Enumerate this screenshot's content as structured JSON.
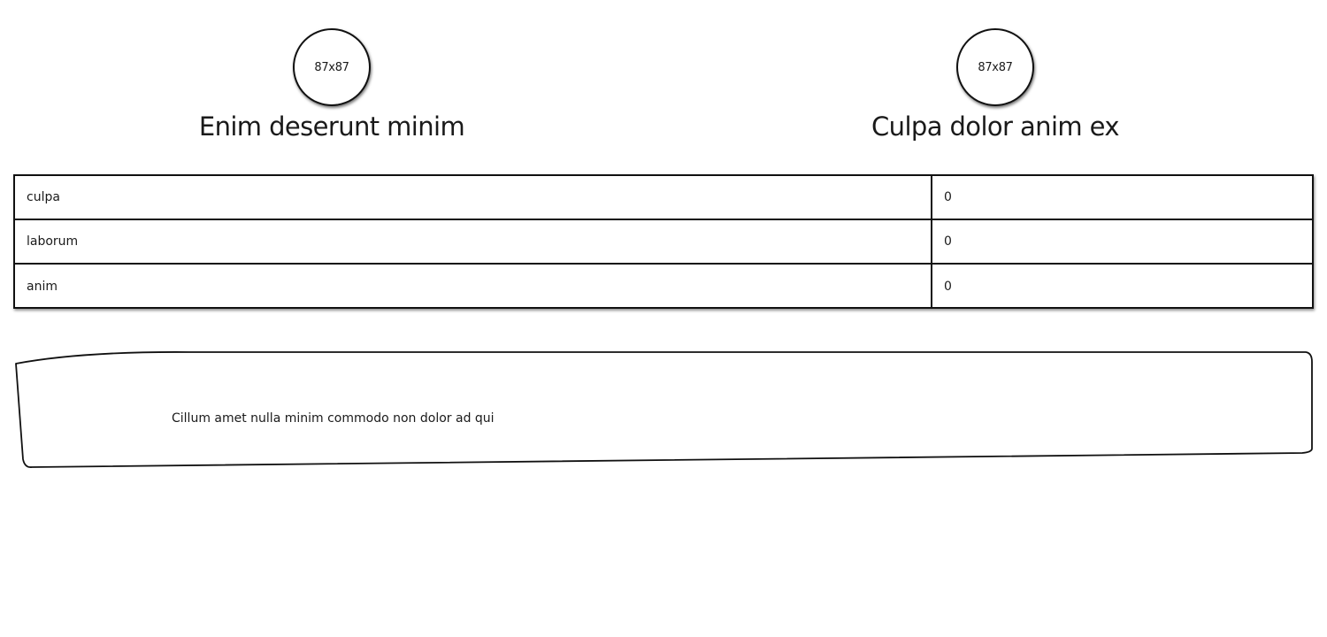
{
  "profiles": [
    {
      "avatar_text": "87x87",
      "name": "Enim deserunt minim"
    },
    {
      "avatar_text": "87x87",
      "name": "Culpa dolor anim ex"
    }
  ],
  "table": {
    "rows": [
      {
        "key": "culpa",
        "value": "0"
      },
      {
        "key": "laborum",
        "value": "0"
      },
      {
        "key": "anim",
        "value": "0"
      }
    ]
  },
  "note": {
    "text": "Cillum amet nulla minim commodo non dolor ad qui"
  }
}
